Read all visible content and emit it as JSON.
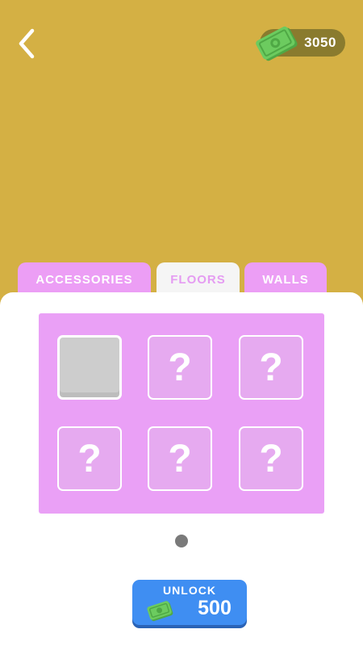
{
  "header": {
    "back_icon": "chevron-left-icon",
    "currency": {
      "icon": "cash-icon",
      "amount": "3050"
    }
  },
  "tabs": [
    {
      "label": "ACCESSORIES",
      "selected": false
    },
    {
      "label": "FLOORS",
      "selected": true
    },
    {
      "label": "WALLS",
      "selected": false
    }
  ],
  "grid": {
    "items": [
      {
        "state": "unlocked"
      },
      {
        "state": "locked",
        "symbol": "?"
      },
      {
        "state": "locked",
        "symbol": "?"
      },
      {
        "state": "locked",
        "symbol": "?"
      },
      {
        "state": "locked",
        "symbol": "?"
      },
      {
        "state": "locked",
        "symbol": "?"
      }
    ]
  },
  "pagination": {
    "pages": 1,
    "current": 1
  },
  "unlock_button": {
    "label": "UNLOCK",
    "price": "500",
    "icon": "cash-icon"
  },
  "colors": {
    "background": "#D4B044",
    "tab_pink": "#EC9EF5",
    "grid_pink": "#EAA0F6",
    "button_blue": "#3F8EF2",
    "cash_green": "#6CCB5F"
  }
}
